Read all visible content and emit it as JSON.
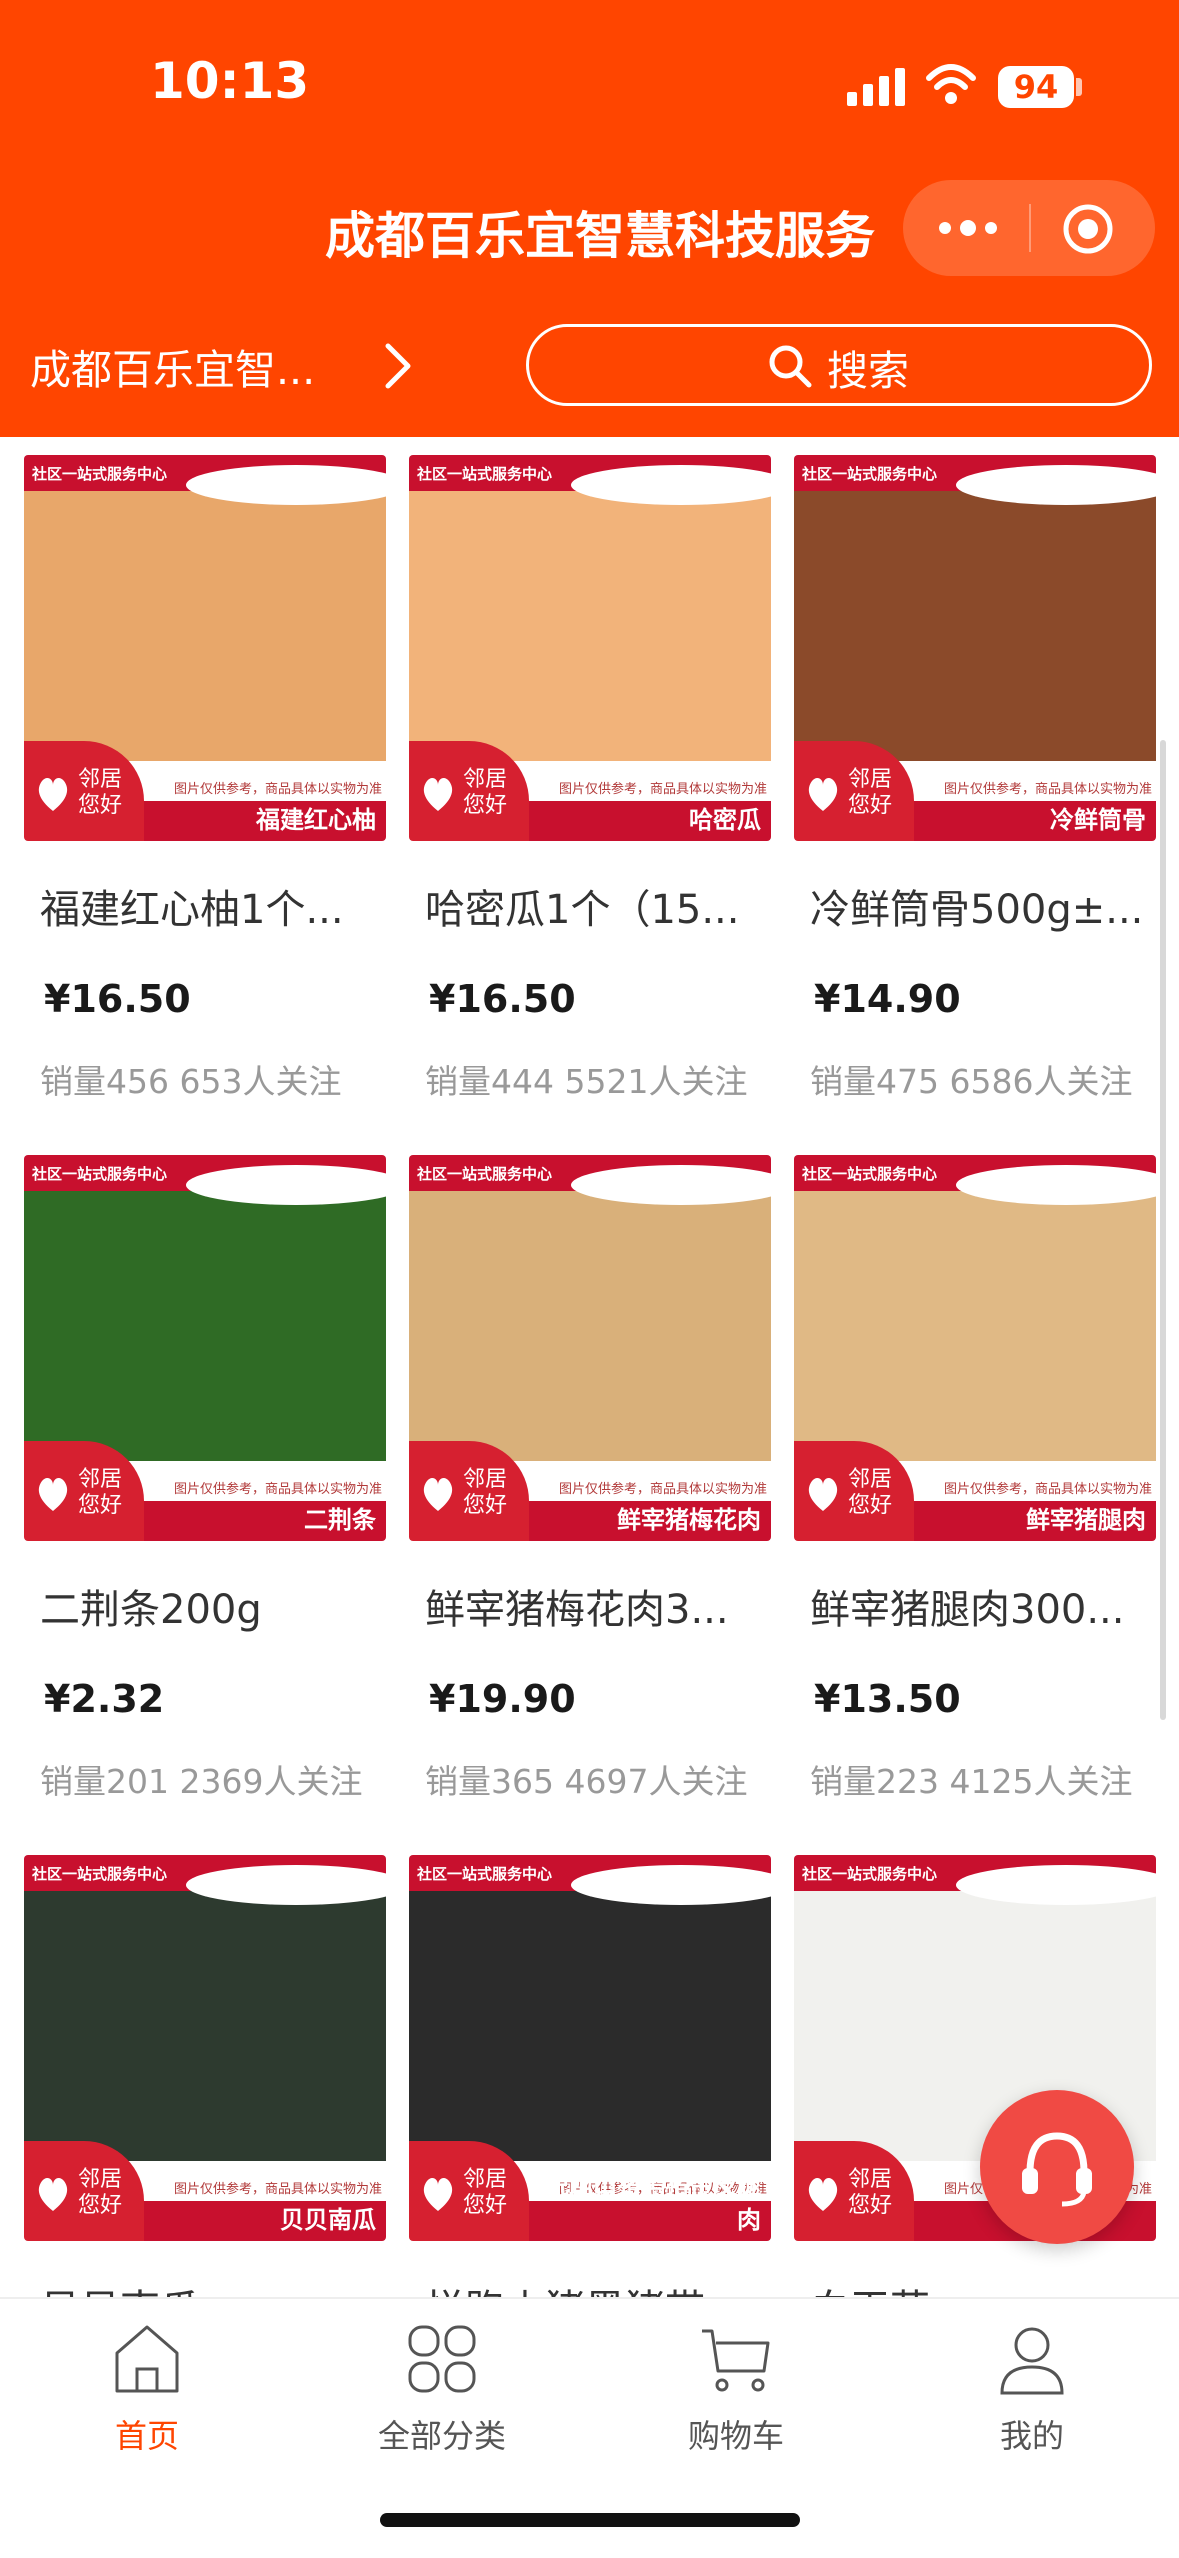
{
  "status_bar": {
    "time": "10:13",
    "battery": "94"
  },
  "nav": {
    "title": "成都百乐宜智慧科技服务"
  },
  "store": {
    "name": "成都百乐宜智..."
  },
  "search": {
    "label": "搜索"
  },
  "image_common": {
    "top_badge": "社区一站式服务中心",
    "logo_text_line1": "邻居",
    "logo_text_line2": "您好",
    "disclaimer": "图片仅供参考，商品具体以实物为准"
  },
  "products": [
    {
      "name": "福建红心柚1个...",
      "price": "¥16.50",
      "sales": "销量456",
      "followers": "653人关注",
      "band": "福建红心柚",
      "img_color": "#e8a76a"
    },
    {
      "name": "哈密瓜1个（15...",
      "price": "¥16.50",
      "sales": "销量444",
      "followers": "5521人关注",
      "band": "哈密瓜",
      "img_color": "#f2b37a"
    },
    {
      "name": "冷鲜筒骨500g±...",
      "price": "¥14.90",
      "sales": "销量475",
      "followers": "6586人关注",
      "band": "冷鲜筒骨",
      "img_color": "#8b4a2a"
    },
    {
      "name": "二荆条200g",
      "price": "¥2.32",
      "sales": "销量201",
      "followers": "2369人关注",
      "band": "二荆条",
      "img_color": "#2f6b25"
    },
    {
      "name": "鲜宰猪梅花肉3...",
      "price": "¥19.90",
      "sales": "销量365",
      "followers": "4697人关注",
      "band": "鲜宰猪梅花肉",
      "img_color": "#d9b07a"
    },
    {
      "name": "鲜宰猪腿肉300...",
      "price": "¥13.50",
      "sales": "销量223",
      "followers": "4125人关注",
      "band": "鲜宰猪腿肉",
      "img_color": "#e0b985"
    },
    {
      "name": "贝贝南瓜",
      "price": "",
      "sales": "",
      "followers": "",
      "band": "贝贝南瓜",
      "img_color": "#2d3a2f"
    },
    {
      "name": "悦跑山猪黑猪带皮腿肉",
      "price": "",
      "sales": "",
      "followers": "",
      "band": "悦跑山猪黑猪带皮腿肉",
      "img_color": "#2b2b2b"
    },
    {
      "name": "白玉菇",
      "price": "",
      "sales": "",
      "followers": "",
      "band": "",
      "img_color": "#f1f1ee"
    }
  ],
  "tabs": [
    {
      "label": "首页",
      "icon": "home-icon",
      "active": true
    },
    {
      "label": "全部分类",
      "icon": "category-icon",
      "active": false
    },
    {
      "label": "购物车",
      "icon": "cart-icon",
      "active": false
    },
    {
      "label": "我的",
      "icon": "user-icon",
      "active": false
    }
  ],
  "colors": {
    "brand": "#ff4500",
    "badge_red": "#c8102e",
    "fab": "#f04a44"
  }
}
